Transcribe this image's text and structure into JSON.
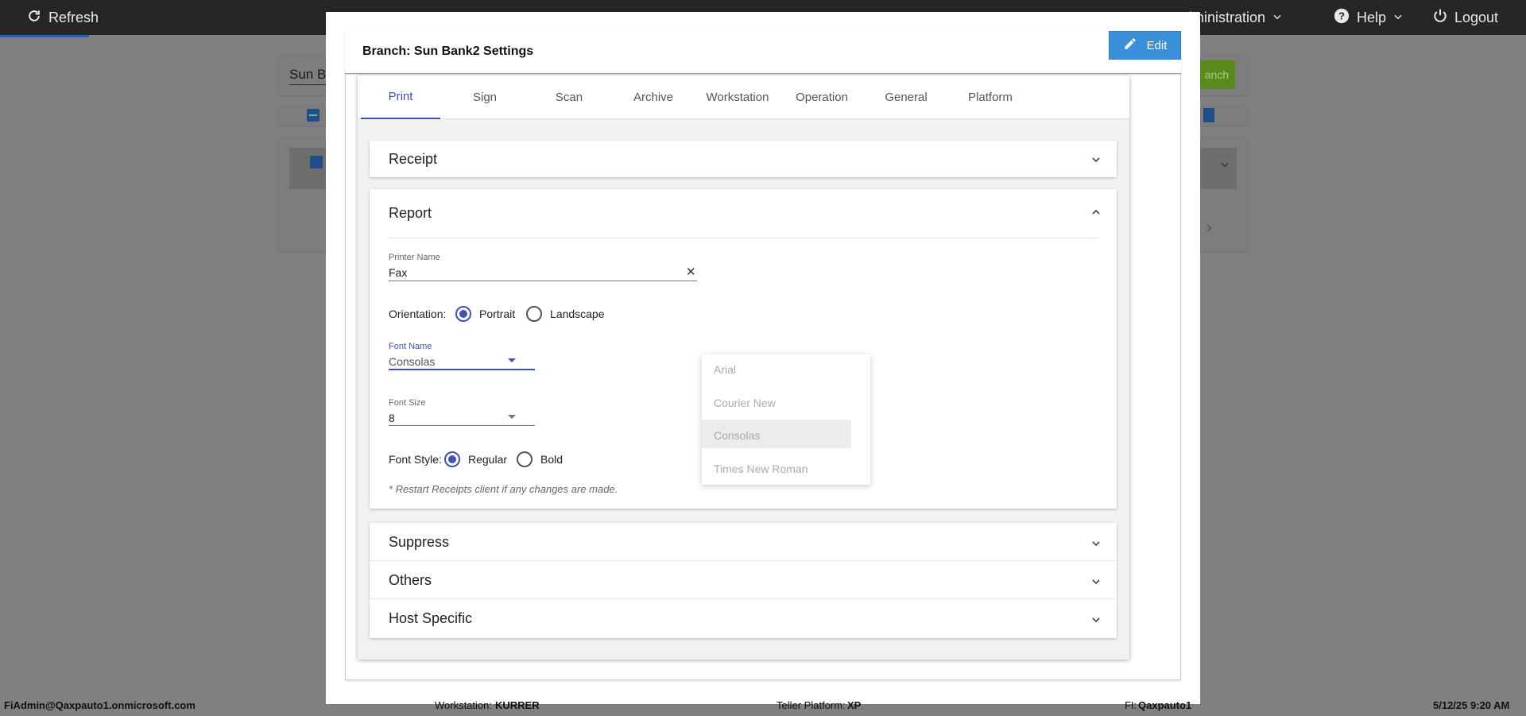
{
  "topbar": {
    "refresh_label": "Refresh",
    "admin_label": "Administration",
    "help_label": "Help",
    "logout_label": "Logout"
  },
  "background": {
    "search_value": "Sun Ba",
    "add_button_label": "anch"
  },
  "modal": {
    "title": "Branch: Sun Bank2 Settings",
    "edit_label": "Edit",
    "tabs": [
      {
        "label": "Print",
        "active": true
      },
      {
        "label": "Sign"
      },
      {
        "label": "Scan"
      },
      {
        "label": "Archive"
      },
      {
        "label": "Workstation"
      },
      {
        "label": "Operation"
      },
      {
        "label": "General"
      },
      {
        "label": "Platform"
      }
    ],
    "panels": {
      "receipt": "Receipt",
      "report": "Report",
      "suppress": "Suppress",
      "others": "Others",
      "host_specific": "Host Specific"
    },
    "report": {
      "printer_name_label": "Printer Name",
      "printer_name_value": "Fax",
      "orientation_label": "Orientation:",
      "orientation_options": [
        "Portrait",
        "Landscape"
      ],
      "orientation_selected": "Portrait",
      "font_name_label": "Font Name",
      "font_name_value": "Consolas",
      "font_name_options": [
        "Arial",
        "Courier New",
        "Consolas",
        "Times New Roman"
      ],
      "font_size_label": "Font Size",
      "font_size_value": "8",
      "font_style_label": "Font Style:",
      "font_style_options": [
        "Regular",
        "Bold"
      ],
      "font_style_selected": "Regular",
      "note": "* Restart Receipts client if any changes are made."
    }
  },
  "footer": {
    "user": "FiAdmin@Qaxpauto1.onmicrosoft.com",
    "workstation_label": "Workstation:",
    "workstation_value": "KURRER",
    "platform_label": "Teller Platform:",
    "platform_value": "XP",
    "fi_label": "FI:",
    "fi_value": "Qaxpauto1",
    "datetime": "5/12/25 9:20 AM"
  },
  "colors": {
    "accent": "#3f51b5",
    "edit_button": "#3a8fd9",
    "topbar": "#262626",
    "overlay": "#808080"
  }
}
